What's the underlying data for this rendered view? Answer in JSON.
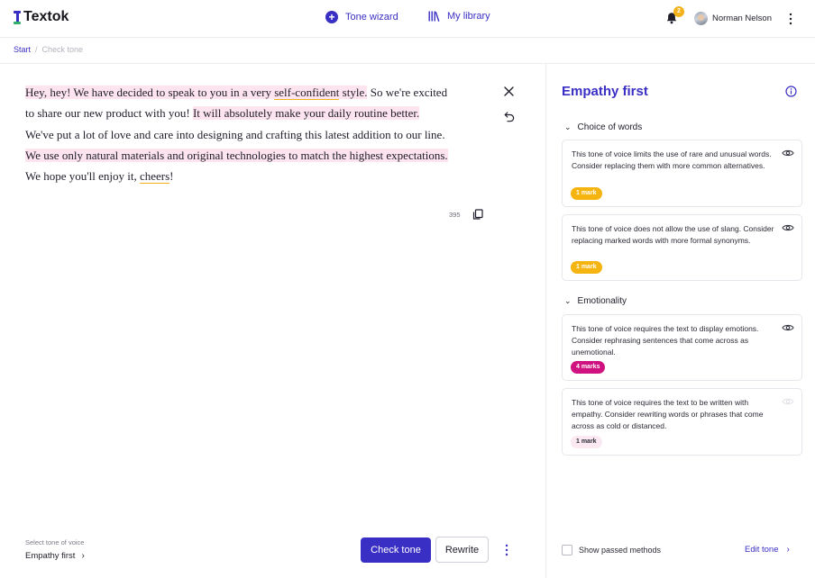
{
  "app": {
    "name": "Textok"
  },
  "nav": {
    "tone_wizard": "Tone wizard",
    "my_library": "My library"
  },
  "notifications": {
    "count": "2"
  },
  "user": {
    "name": "Norman Nelson"
  },
  "breadcrumb": {
    "start": "Start",
    "separator": "/",
    "current": "Check tone"
  },
  "editor": {
    "segments": {
      "s1": "Hey, hey! We have decided to speak to you in a very ",
      "s2": "self-confident",
      "s3": " style.",
      "s4": " So we're excited",
      "s5": "to  share our new product with you! ",
      "s6": "It will absolutely make your daily routine better.",
      "s7": "We've put a lot of love and care into designing and crafting this latest addition to our line.",
      "s8": "We use only natural materials and original technologies to match the highest expectations.",
      "s9": "We hope you'll enjoy it, ",
      "s10": "cheers",
      "s11": "!"
    },
    "char_count": "395"
  },
  "footer": {
    "select_label": "Select tone of voice",
    "selected_tone": "Empathy first",
    "check_button": "Check tone",
    "rewrite_button": "Rewrite"
  },
  "panel": {
    "title": "Empathy first",
    "sections": [
      {
        "title": "Choice of words",
        "cards": [
          {
            "text": "This tone of voice limits the use of rare and unusual words. Consider replacing them with more common alternatives.",
            "badge": "1 mark"
          },
          {
            "text": "This tone of voice does not allow the use of slang. Consider replacing marked words with more formal synonyms.",
            "badge": "1 mark"
          }
        ]
      },
      {
        "title": "Emotionality",
        "cards": [
          {
            "text": "This tone of voice requires the text to display emotions. Consider rephrasing sentences that come across as unemotional.",
            "badge": "4 marks"
          },
          {
            "text": "This tone of voice requires the text to be written with empathy. Consider rewriting words or phrases that come across as cold or distanced.",
            "badge": "1 mark"
          }
        ]
      }
    ],
    "show_passed_label": "Show passed methods",
    "edit_tone_label": "Edit tone"
  },
  "colors": {
    "accent": "#3a2fc4",
    "highlight": "#fde4ef",
    "warning_badge": "#f5b40f",
    "emotion_badge": "#cf1280",
    "notification_badge": "#f3b21c"
  },
  "icons": [
    "plus-circle-icon",
    "library-icon",
    "bell-icon",
    "close-icon",
    "undo-icon",
    "copy-icon",
    "kebab-icon",
    "info-icon",
    "eye-icon",
    "chevron-down-icon",
    "chevron-right-icon"
  ]
}
